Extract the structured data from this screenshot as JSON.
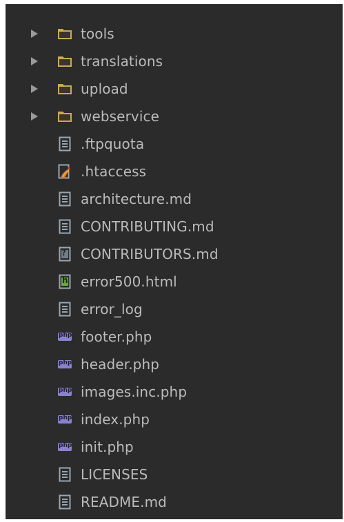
{
  "tree": {
    "items": [
      {
        "label": "tools",
        "type": "folder",
        "icon": "folder-icon"
      },
      {
        "label": "translations",
        "type": "folder",
        "icon": "folder-icon"
      },
      {
        "label": "upload",
        "type": "folder",
        "icon": "folder-icon"
      },
      {
        "label": "webservice",
        "type": "folder",
        "icon": "folder-icon"
      },
      {
        "label": ".ftpquota",
        "type": "file",
        "icon": "text-file-icon"
      },
      {
        "label": ".htaccess",
        "type": "file",
        "icon": "htaccess-file-icon"
      },
      {
        "label": "architecture.md",
        "type": "file",
        "icon": "text-file-icon"
      },
      {
        "label": "CONTRIBUTING.md",
        "type": "file",
        "icon": "text-file-icon"
      },
      {
        "label": "CONTRIBUTORS.md",
        "type": "file",
        "icon": "unknown-file-icon"
      },
      {
        "label": "error500.html",
        "type": "file",
        "icon": "html-file-icon"
      },
      {
        "label": "error_log",
        "type": "file",
        "icon": "text-file-icon"
      },
      {
        "label": "footer.php",
        "type": "file",
        "icon": "php-file-icon"
      },
      {
        "label": "header.php",
        "type": "file",
        "icon": "php-file-icon"
      },
      {
        "label": "images.inc.php",
        "type": "file",
        "icon": "php-file-icon"
      },
      {
        "label": "index.php",
        "type": "file",
        "icon": "php-file-icon"
      },
      {
        "label": "init.php",
        "type": "file",
        "icon": "php-file-icon"
      },
      {
        "label": "LICENSES",
        "type": "file",
        "icon": "text-file-icon"
      },
      {
        "label": "README.md",
        "type": "file",
        "icon": "text-file-icon"
      }
    ],
    "icon_text": {
      "php": "php",
      "html": "h",
      "unknown": "?"
    }
  },
  "colors": {
    "background": "#2b2b2b",
    "text": "#bbbbbb",
    "folder": "#c9a95a",
    "php": "#8a82cc",
    "html": "#6aab3c"
  }
}
